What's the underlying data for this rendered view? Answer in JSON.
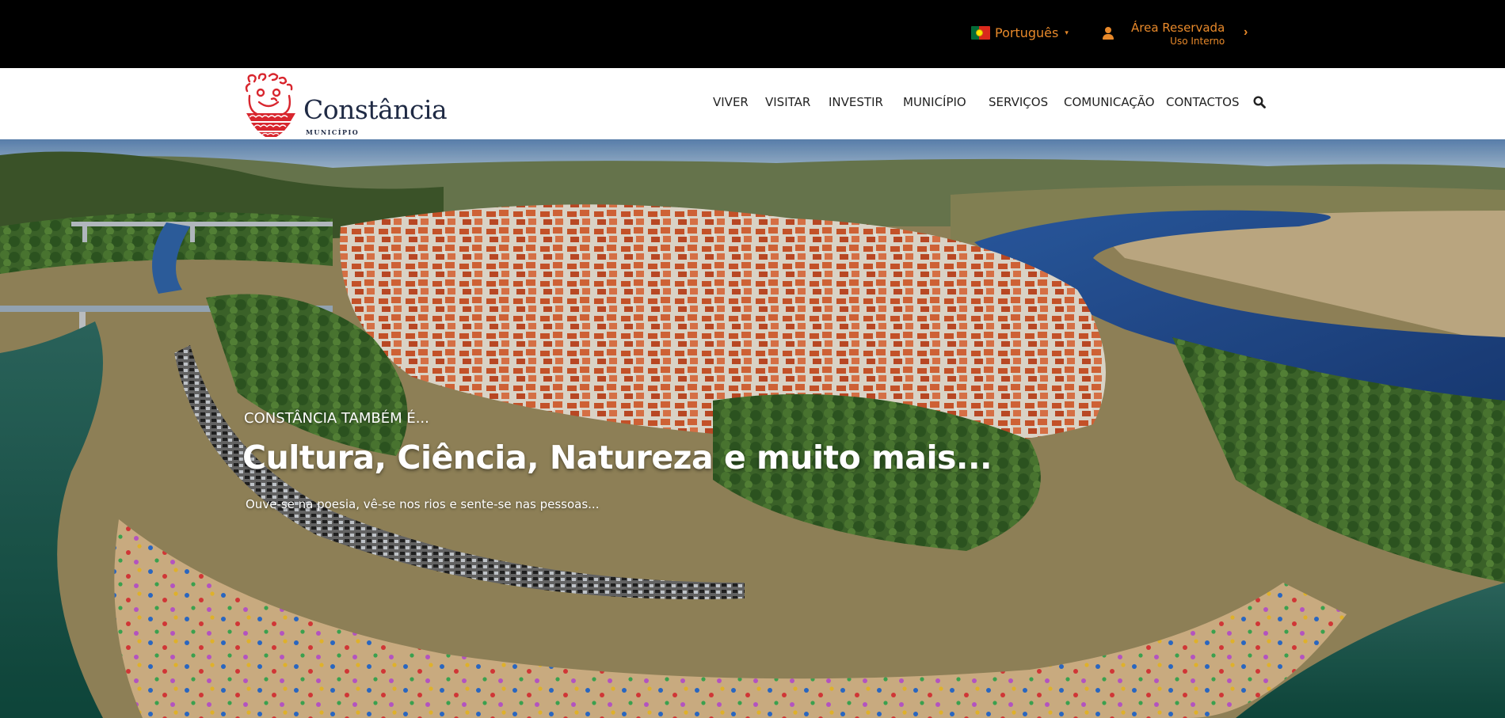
{
  "topbar": {
    "language": {
      "label": "Português",
      "flag": "portugal-flag",
      "caret": "▾"
    },
    "reserved_area": {
      "title": "Área Reservada",
      "subtitle": "Uso Interno",
      "icon": "user-icon",
      "arrow": "›"
    },
    "accent_color": "#e8892a"
  },
  "header": {
    "logo": {
      "name": "Constância",
      "subtitle": "MUNICÍPIO"
    },
    "nav": [
      "VIVER",
      "VISITAR",
      "INVESTIR",
      "MUNICÍPIO",
      "SERVIÇOS",
      "COMUNICAÇÃO",
      "CONTACTOS"
    ],
    "search_icon": "search-icon"
  },
  "hero": {
    "kicker": "CONSTÂNCIA TAMBÉM É...",
    "title": "Cultura, Ciência, Natureza e muito mais...",
    "subtitle": "Ouve-se na poesia, vê-se nos rios e sente-se nas pessoas..."
  }
}
